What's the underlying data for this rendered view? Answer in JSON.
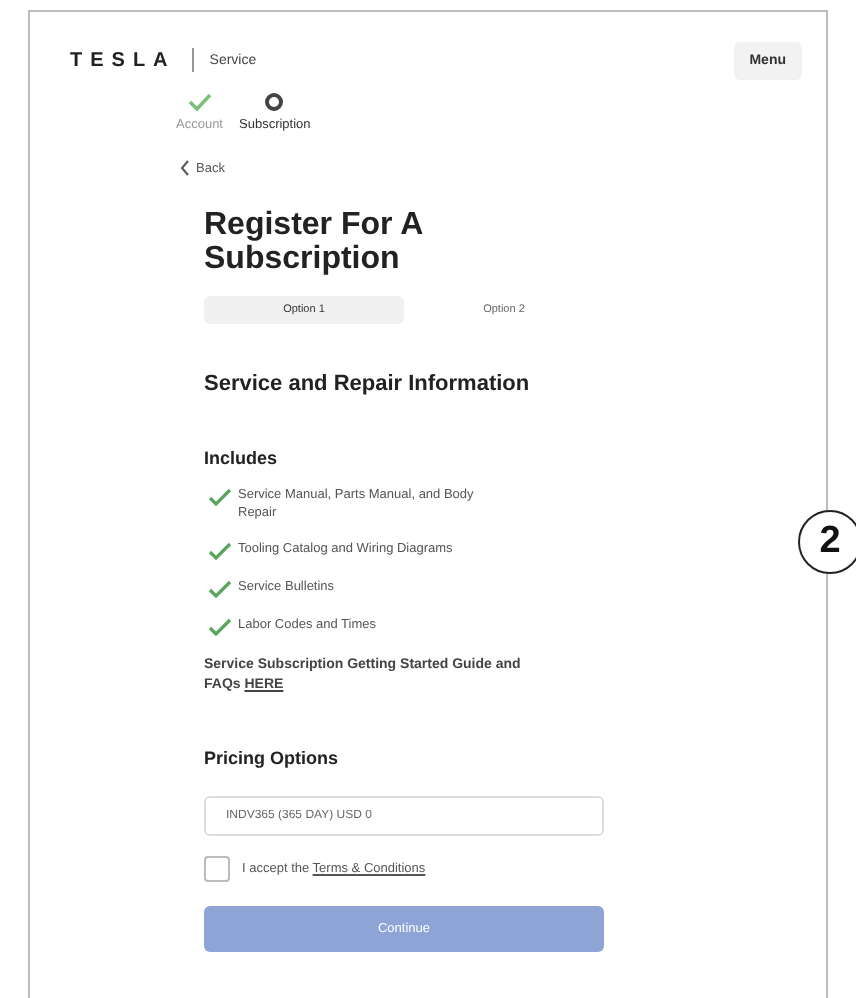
{
  "header": {
    "logo": "TESLA",
    "section": "Service",
    "menu": "Menu"
  },
  "steps": [
    {
      "label": "Account",
      "done": true,
      "selected": false
    },
    {
      "label": "Subscription",
      "done": false,
      "selected": true
    }
  ],
  "back": "Back",
  "title": "Register For A Subscription",
  "tabs": [
    {
      "label": "Option 1",
      "selected": true
    },
    {
      "label": "Option 2",
      "selected": false
    }
  ],
  "section_title": "Service and Repair Information",
  "includes_title": "Includes",
  "includes": [
    "Service Manual, Parts Manual, and Body Repair",
    "Tooling Catalog and Wiring Diagrams",
    "Service Bulletins",
    "Labor Codes and Times"
  ],
  "guide": {
    "text": "Service Subscription Getting Started Guide and FAQs",
    "link": "HERE"
  },
  "pricing_title": "Pricing Options",
  "pricing_field": {
    "value": "INDV365 (365 DAY) USD 0"
  },
  "terms": {
    "checked": false,
    "text": "I accept the",
    "link": "Terms & Conditions"
  },
  "continue_button": {
    "label": "Continue",
    "disabled": true
  },
  "callout": "2"
}
